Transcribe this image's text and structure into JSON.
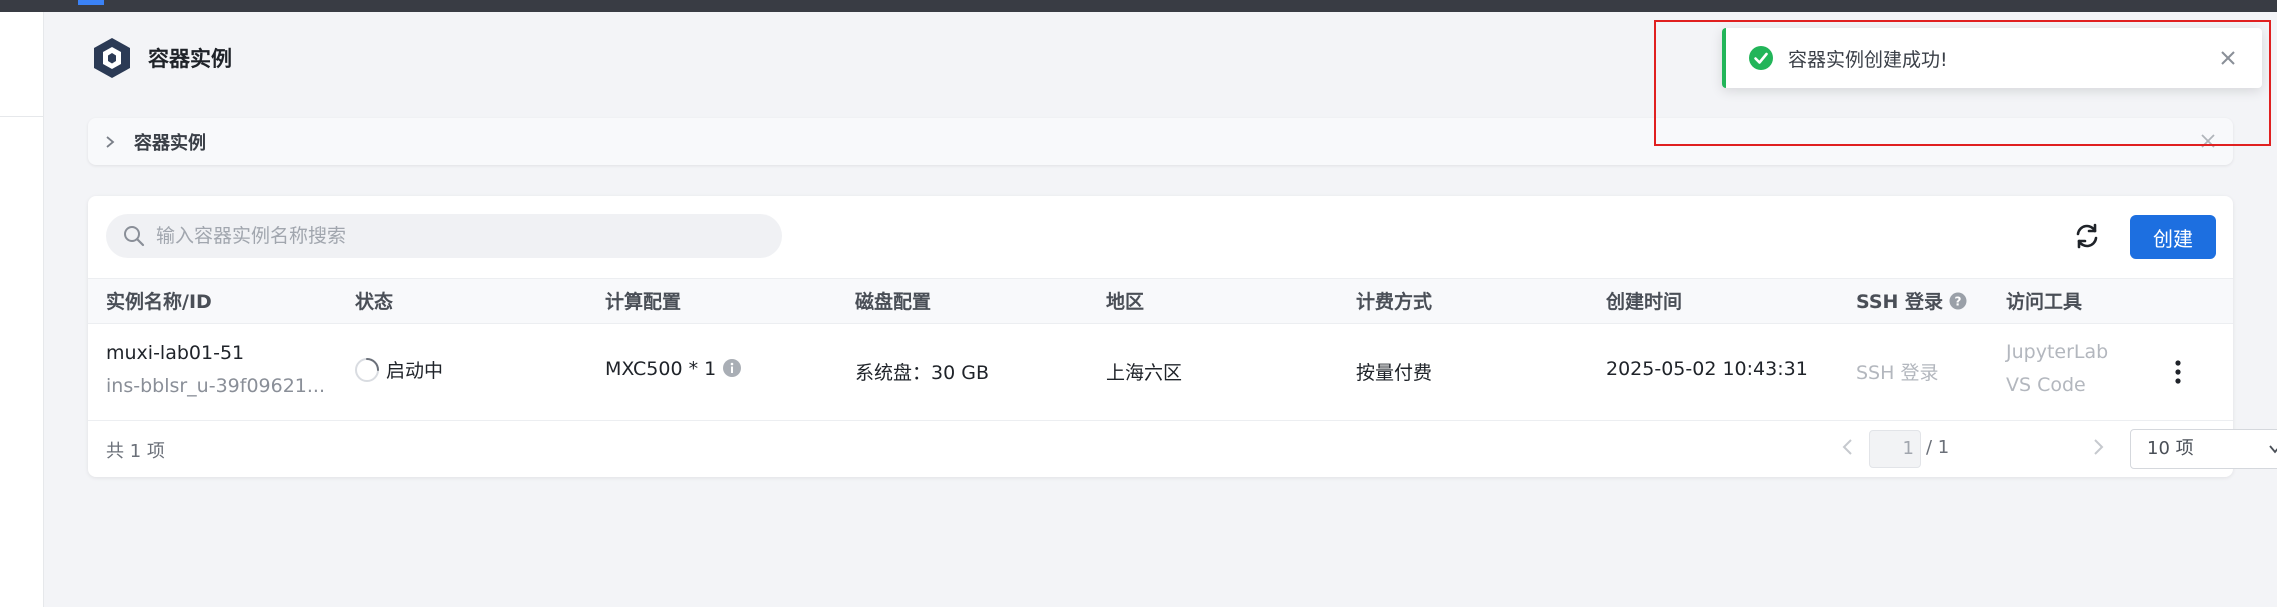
{
  "page": {
    "title": "容器实例"
  },
  "collapse": {
    "label": "容器实例"
  },
  "search": {
    "placeholder": "输入容器实例名称搜索"
  },
  "toolbar": {
    "create_label": "创建"
  },
  "table": {
    "headers": {
      "name": "实例名称/ID",
      "status": "状态",
      "compute": "计算配置",
      "disk": "磁盘配置",
      "region": "地区",
      "billing": "计费方式",
      "created": "创建时间",
      "ssh": "SSH 登录",
      "tools": "访问工具"
    },
    "rows": [
      {
        "name": "muxi-lab01-51",
        "id": "ins-bblsr_u-39f09621...",
        "status": "启动中",
        "compute": "MXC500 * 1",
        "disk": "系统盘：30 GB",
        "region": "上海六区",
        "billing": "按量付费",
        "created": "2025-05-02 10:43:31",
        "ssh": "SSH 登录",
        "tool1": "JupyterLab",
        "tool2": "VS Code"
      }
    ]
  },
  "pagination": {
    "total": "共 1 项",
    "current": "1",
    "pages": "/ 1",
    "page_size": "10 项"
  },
  "toast": {
    "message": "容器实例创建成功!"
  },
  "colors": {
    "primary": "#1d6fe0",
    "success": "#22b559",
    "highlight": "#e02020",
    "topbar": "#393c44"
  },
  "icons": [
    "logo-icon",
    "chevron-right-icon",
    "close-icon",
    "search-icon",
    "refresh-icon",
    "help-icon",
    "spinner-icon",
    "info-icon",
    "more-vertical-icon",
    "chevron-left-icon",
    "chevron-down-icon",
    "check-circle-icon"
  ]
}
